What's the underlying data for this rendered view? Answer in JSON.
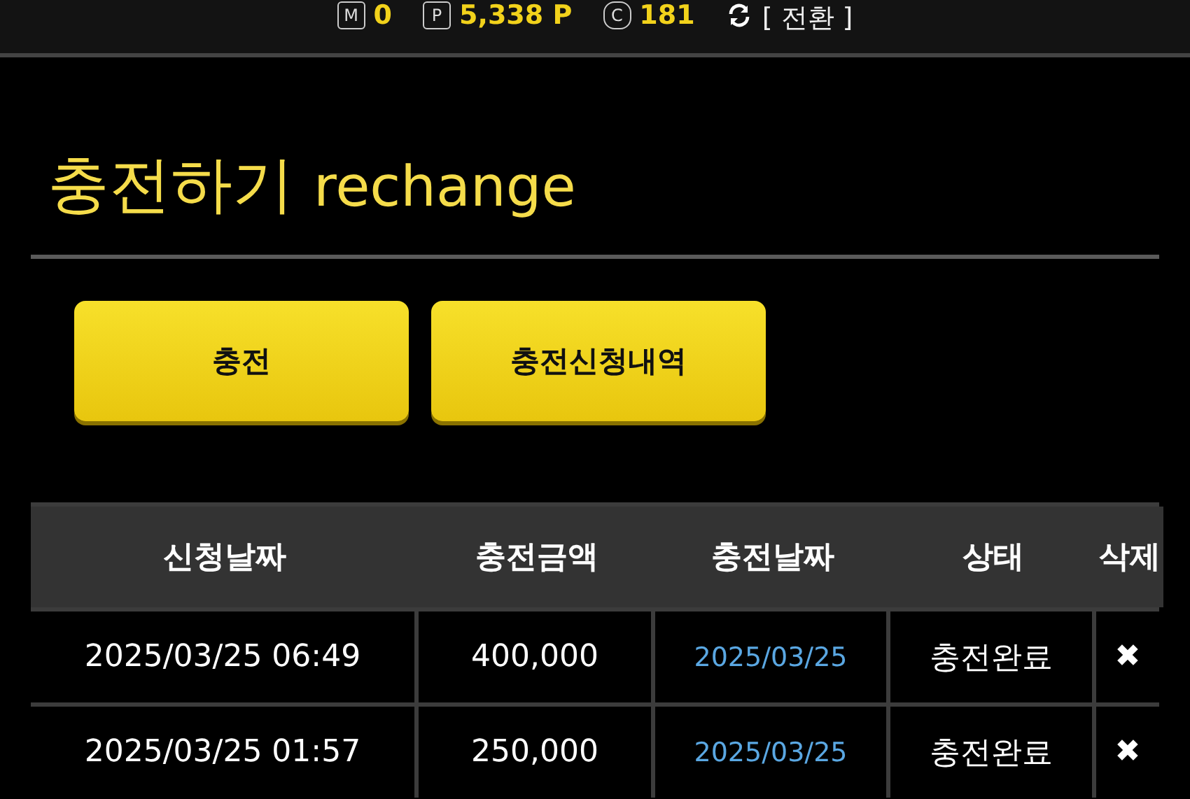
{
  "top_bar": {
    "items": [
      {
        "kind": "box",
        "badge": "M",
        "value": "0"
      },
      {
        "kind": "box",
        "badge": "P",
        "value": "5,338 P"
      },
      {
        "kind": "round",
        "badge": "C",
        "value": "181"
      }
    ],
    "convert_link": "[ 전환 ]"
  },
  "heading": {
    "title": "충전하기",
    "subtitle": "rechange"
  },
  "buttons": [
    {
      "label": "충전"
    },
    {
      "label": "충전신청내역"
    }
  ],
  "table": {
    "columns": [
      "신청날짜",
      "충전금액",
      "충전날짜",
      "상태",
      "삭제"
    ],
    "rows": [
      {
        "requested": "2025/03/25 06:49",
        "amount": "400,000",
        "charged": "2025/03/25",
        "status": "충전완료",
        "delete": "✖"
      },
      {
        "requested": "2025/03/25 01:57",
        "amount": "250,000",
        "charged": "2025/03/25",
        "status": "충전완료",
        "delete": "✖"
      }
    ]
  }
}
